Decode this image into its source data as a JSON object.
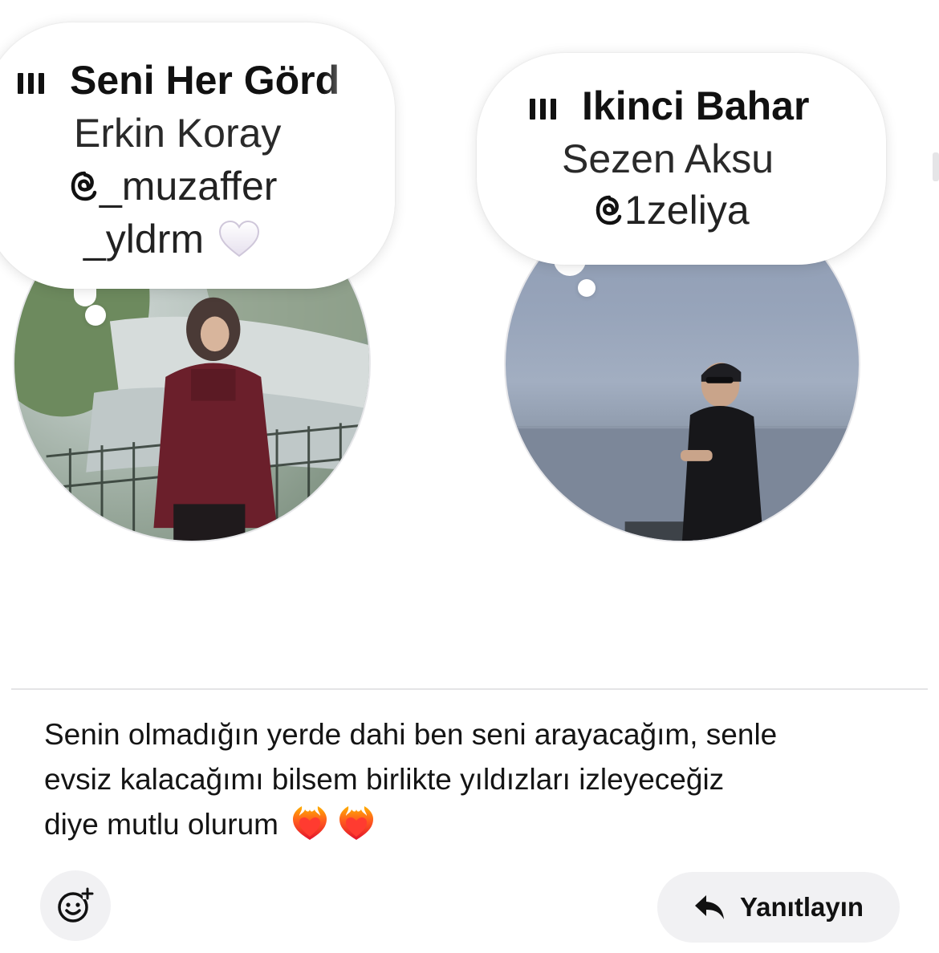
{
  "story_left": {
    "song_title": "Seni Her Görd",
    "artist": "Erkin Koray",
    "handle_line1": "_muzaffer",
    "handle_line2": "_yldrm",
    "icons": [
      "music-bars-icon",
      "threads-icon",
      "white-heart-icon"
    ]
  },
  "story_right": {
    "song_title": "Ikinci Bahar",
    "artist": "Sezen Aksu",
    "handle": "1zeliya",
    "icons": [
      "music-bars-icon",
      "threads-icon"
    ]
  },
  "message": {
    "lines": [
      "Senin olmadığın yerde dahi ben seni arayacağım, senle",
      "evsiz kalacağımı bilsem birlikte yıldızları izleyeceğiz",
      "diye mutlu olurum"
    ],
    "emojis": [
      "heart-on-fire-icon",
      "heart-on-fire-icon"
    ]
  },
  "actions": {
    "react_icon": "add-reaction-icon",
    "reply_icon": "reply-arrow-icon",
    "reply_label": "Yanıtlayın"
  },
  "colors": {
    "button_bg": "#f1f1f3",
    "divider": "#e4e4e6",
    "text": "#141414"
  }
}
